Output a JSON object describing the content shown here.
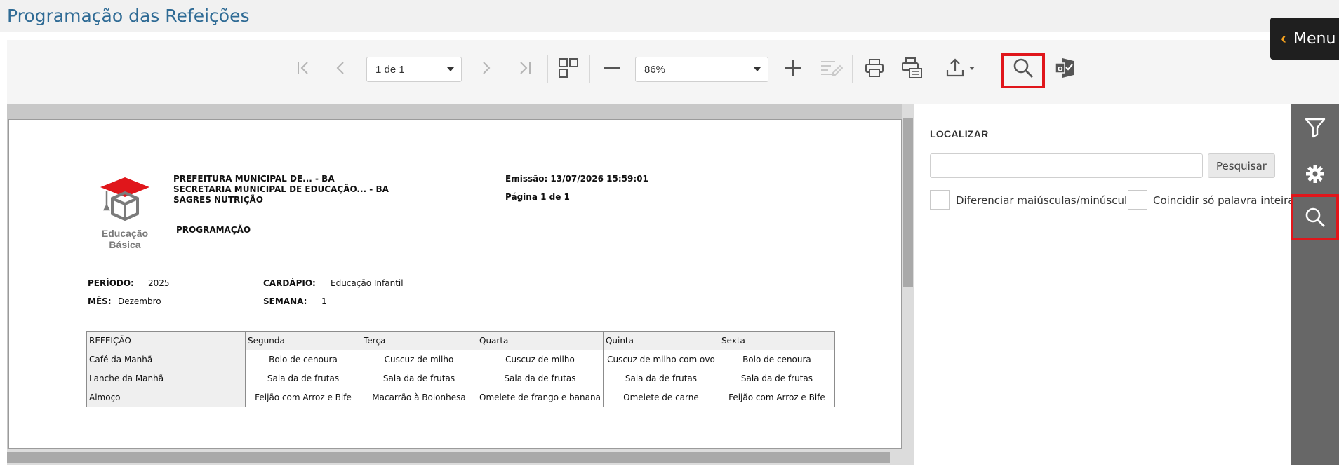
{
  "page": {
    "title": "Programação das Refeições"
  },
  "menu_button": {
    "label": "Menu"
  },
  "toolbar": {
    "page_selector": "1 de 1",
    "zoom_selector": "86%",
    "icons": [
      "first-page-icon",
      "previous-page-icon",
      "next-page-icon",
      "last-page-icon",
      "multipage-icon",
      "zoom-out-icon",
      "zoom-in-icon",
      "edit-icon",
      "print-icon",
      "print-pdf-icon",
      "export-icon",
      "search-icon",
      "outlook-icon"
    ],
    "active_icon": "search-icon"
  },
  "report": {
    "logo": {
      "line1": "Educação",
      "line2": "Básica"
    },
    "header_lines": [
      "PREFEITURA MUNICIPAL DE... - BA",
      "SECRETARIA MUNICIPAL DE EDUCAÇÃO... - BA",
      "SAGRES NUTRIÇÃO"
    ],
    "subtitle": "PROGRAMAÇÃO",
    "emissao": "Emissão: 13/07/2026 15:59:01",
    "pagina": "Página 1 de 1",
    "periodo_label": "PERÍODO:",
    "periodo_value": "2025",
    "mes_label": "MÊS:",
    "mes_value": "Dezembro",
    "cardapio_label": "CARDÁPIO:",
    "cardapio_value": "Educação Infantil",
    "semana_label": "SEMANA:",
    "semana_value": "1",
    "table": {
      "columns": [
        "REFEIÇÃO",
        "Segunda",
        "Terça",
        "Quarta",
        "Quinta",
        "Sexta"
      ],
      "rows": [
        [
          "Café da Manhã",
          "Bolo de cenoura",
          "Cuscuz de milho",
          "Cuscuz de milho",
          "Cuscuz de milho com ovo",
          "Bolo de cenoura"
        ],
        [
          "Lanche da Manhã",
          "Sala da de frutas",
          "Sala da de frutas",
          "Sala da de frutas",
          "Sala da de frutas",
          "Sala da de frutas"
        ],
        [
          "Almoço",
          "Feijão com Arroz e Bife",
          "Macarrão à Bolonhesa",
          "Omelete de frango e banana",
          "Omelete de carne",
          "Feijão com Arroz e Bife"
        ]
      ]
    }
  },
  "find_panel": {
    "title": "LOCALIZAR",
    "input_value": "",
    "search_button": "Pesquisar",
    "option_case": "Diferenciar maiúsculas/minúsculas",
    "option_whole_word": "Coincidir só palavra inteira"
  },
  "side_rail": {
    "items": [
      "filter-icon",
      "settings-icon",
      "search-icon"
    ],
    "active": "search-icon"
  },
  "colors": {
    "title_blue": "#2f6b95",
    "highlight_red": "#e0161b",
    "rail_gray": "#676767",
    "menu_dark": "#1f1f1f",
    "menu_chevron": "#f4a11e"
  }
}
